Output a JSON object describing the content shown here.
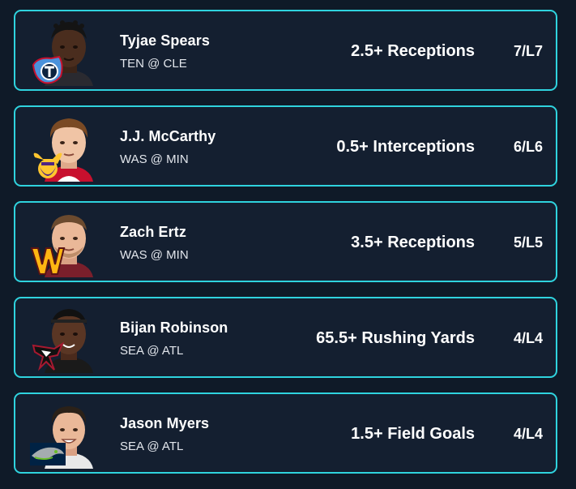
{
  "colors": {
    "background": "#0f1a28",
    "card_background": "#141f30",
    "card_border": "#2fd3de",
    "text_primary": "#ffffff",
    "text_secondary": "#e2e6ec"
  },
  "cards": [
    {
      "player": "Tyjae Spears",
      "matchup": "TEN @ CLE",
      "prop": "2.5+ Receptions",
      "hit_rate": "7/L7",
      "team_logo_icon": "titans-logo-icon",
      "headshot_icon": "player-headshot-icon"
    },
    {
      "player": "J.J. McCarthy",
      "matchup": "WAS @ MIN",
      "prop": "0.5+ Interceptions",
      "hit_rate": "6/L6",
      "team_logo_icon": "vikings-logo-icon",
      "headshot_icon": "player-headshot-icon"
    },
    {
      "player": "Zach Ertz",
      "matchup": "WAS @ MIN",
      "prop": "3.5+ Receptions",
      "hit_rate": "5/L5",
      "team_logo_icon": "commanders-logo-icon",
      "headshot_icon": "player-headshot-icon"
    },
    {
      "player": "Bijan Robinson",
      "matchup": "SEA @ ATL",
      "prop": "65.5+ Rushing Yards",
      "hit_rate": "4/L4",
      "team_logo_icon": "falcons-logo-icon",
      "headshot_icon": "player-headshot-icon"
    },
    {
      "player": "Jason Myers",
      "matchup": "SEA @ ATL",
      "prop": "1.5+ Field Goals",
      "hit_rate": "4/L4",
      "team_logo_icon": "seahawks-logo-icon",
      "headshot_icon": "player-headshot-icon"
    }
  ]
}
